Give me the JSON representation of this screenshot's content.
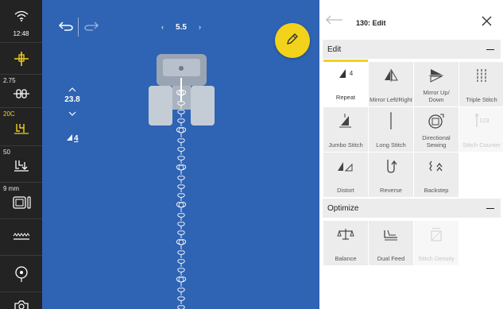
{
  "sidebar": {
    "wifi_label": "12:48",
    "items": [
      {
        "value": "",
        "icon": "needle-icon"
      },
      {
        "value": "2.75",
        "icon": "presser-foot-icon"
      },
      {
        "value": "20C",
        "value_color": "#f2d21b",
        "icon": "stitch-settings-icon"
      },
      {
        "value": "50",
        "icon": "tension-icon"
      },
      {
        "value": "9 mm",
        "icon": "stitch-plate-icon"
      },
      {
        "value": "",
        "icon": "feed-dogs-icon"
      },
      {
        "value": "",
        "icon": "bobbin-icon"
      },
      {
        "value": "",
        "icon": "camera-icon"
      }
    ]
  },
  "canvas": {
    "top_value": "5.5",
    "stitch_length": "23.8",
    "width_value": "4",
    "background": "#2f63b4",
    "fab_color": "#f2d21b"
  },
  "panel": {
    "title": "130: Edit",
    "sections": [
      {
        "title": "Edit",
        "tools": [
          {
            "label": "Repeat",
            "badge": "4",
            "icon": "repeat-icon",
            "active": true
          },
          {
            "label": "Mirror Left/Right",
            "icon": "mirror-left-right-icon"
          },
          {
            "label": "Mirror Up/ Down",
            "icon": "mirror-up-down-icon"
          },
          {
            "label": "Triple Stitch",
            "icon": "triple-stitch-icon"
          },
          {
            "label": "Jumbo Stitch",
            "icon": "jumbo-stitch-icon"
          },
          {
            "label": "Long Stitch",
            "icon": "long-stitch-icon"
          },
          {
            "label": "Directional Sewing",
            "icon": "directional-sewing-icon"
          },
          {
            "label": "Stitch Counter",
            "badge": "123",
            "icon": "stitch-counter-icon",
            "disabled": true
          },
          {
            "label": "Distort",
            "icon": "distort-icon"
          },
          {
            "label": "Reverse",
            "icon": "reverse-icon"
          },
          {
            "label": "Backstep",
            "icon": "backstep-icon"
          }
        ]
      },
      {
        "title": "Optimize",
        "tools": [
          {
            "label": "Balance",
            "icon": "balance-icon"
          },
          {
            "label": "Dual Feed",
            "icon": "dual-feed-icon"
          },
          {
            "label": "Stitch Density",
            "icon": "stitch-density-icon",
            "disabled": true
          }
        ]
      }
    ]
  }
}
